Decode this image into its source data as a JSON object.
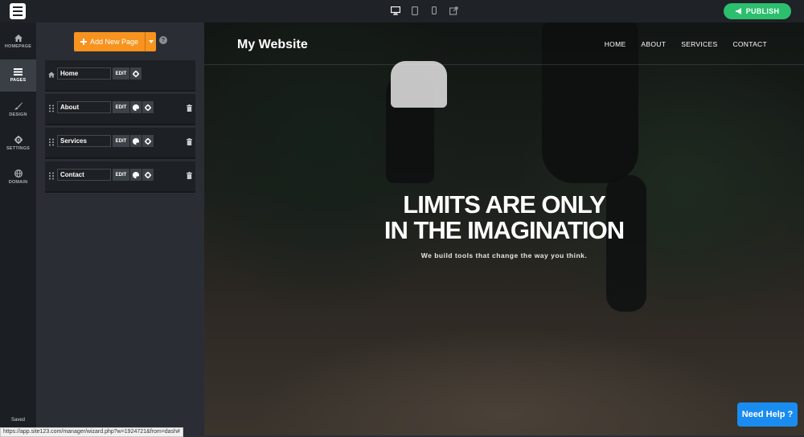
{
  "topbar": {
    "devices": [
      "desktop-icon",
      "tablet-icon",
      "mobile-icon",
      "external-link-icon"
    ],
    "publish_label": "PUBLISH"
  },
  "leftnav": {
    "items": [
      {
        "label": "HOMEPAGE",
        "icon": "home-icon"
      },
      {
        "label": "PAGES",
        "icon": "pages-icon"
      },
      {
        "label": "DESIGN",
        "icon": "brush-icon"
      },
      {
        "label": "SETTINGS",
        "icon": "gear-icon"
      },
      {
        "label": "DOMAIN",
        "icon": "globe-icon"
      }
    ],
    "status": "Saved"
  },
  "pages_panel": {
    "add_label": "Add New Page",
    "edit_label": "EDIT",
    "pages": [
      {
        "name": "Home"
      },
      {
        "name": "About"
      },
      {
        "name": "Services"
      },
      {
        "name": "Contact"
      }
    ]
  },
  "preview": {
    "site_title": "My Website",
    "nav": [
      "HOME",
      "ABOUT",
      "SERVICES",
      "CONTACT"
    ],
    "hero_line1": "LIMITS ARE ONLY",
    "hero_line2": "IN THE IMAGINATION",
    "subtitle": "We build tools that change the way you think."
  },
  "help_button": "Need Help ?",
  "status_url": "https://app.site123.com/manager/wizard.php?w=1924721&from=dash#",
  "colors": {
    "publish": "#2bbf6e",
    "add_page": "#f7931e",
    "help": "#1a8cf0"
  }
}
